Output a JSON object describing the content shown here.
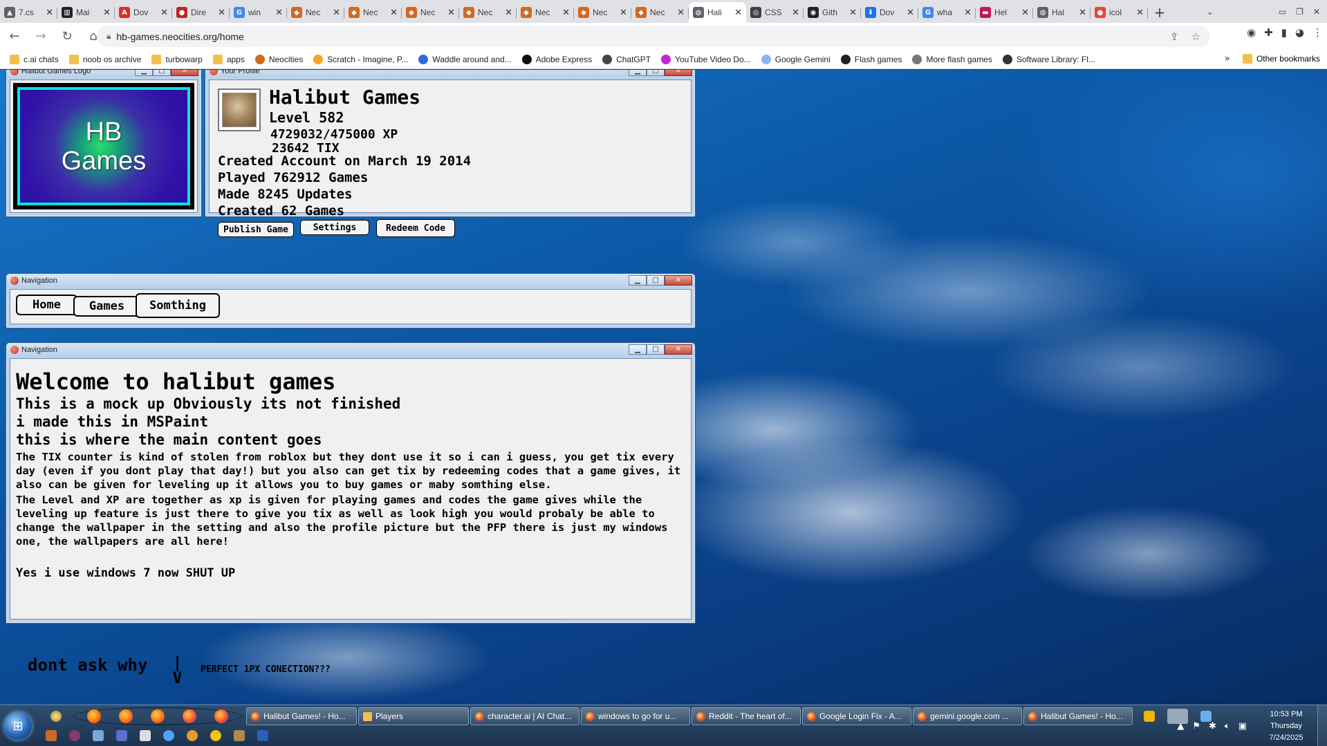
{
  "browser": {
    "tabs": [
      {
        "label": "7.cs",
        "color": "#5f6368",
        "glyph": "▲",
        "active": false
      },
      {
        "label": "Mai",
        "color": "#202124",
        "glyph": "▥",
        "active": false
      },
      {
        "label": "Dov",
        "color": "#d93025",
        "glyph": "A",
        "active": false
      },
      {
        "label": "Dire",
        "color": "#c5221f",
        "glyph": "●",
        "active": false
      },
      {
        "label": "win",
        "color": "#4285f4",
        "glyph": "G",
        "active": false
      },
      {
        "label": "Nec",
        "color": "#d2691e",
        "glyph": "◆",
        "active": false
      },
      {
        "label": "Nec",
        "color": "#d2691e",
        "glyph": "◆",
        "active": false
      },
      {
        "label": "Nec",
        "color": "#d2691e",
        "glyph": "◆",
        "active": false
      },
      {
        "label": "Nec",
        "color": "#d2691e",
        "glyph": "◆",
        "active": false
      },
      {
        "label": "Nec",
        "color": "#d2691e",
        "glyph": "◆",
        "active": false
      },
      {
        "label": "Nec",
        "color": "#d2691e",
        "glyph": "◆",
        "active": false
      },
      {
        "label": "Nec",
        "color": "#d2691e",
        "glyph": "◆",
        "active": false
      },
      {
        "label": "Hali",
        "color": "#5f6368",
        "glyph": "◍",
        "active": true
      },
      {
        "label": "CSS",
        "color": "#3c4043",
        "glyph": "◎",
        "active": false
      },
      {
        "label": "Gith",
        "color": "#202124",
        "glyph": "◉",
        "active": false
      },
      {
        "label": "Dov",
        "color": "#1a73e8",
        "glyph": "⬇",
        "active": false
      },
      {
        "label": "wha",
        "color": "#4285f4",
        "glyph": "G",
        "active": false
      },
      {
        "label": "Hel",
        "color": "#c2185b",
        "glyph": "▬",
        "active": false
      },
      {
        "label": "Hal",
        "color": "#5f6368",
        "glyph": "◍",
        "active": false
      },
      {
        "label": "icol",
        "color": "#ea4335",
        "glyph": "●",
        "active": false
      }
    ],
    "url": "hb-games.neocities.org/home",
    "bookmarks": [
      {
        "label": "c.ai chats",
        "folder": true,
        "color": "#f2c14b"
      },
      {
        "label": "noob os archive",
        "folder": true,
        "color": "#f2c14b"
      },
      {
        "label": "turbowarp",
        "folder": true,
        "color": "#f2c14b"
      },
      {
        "label": "apps",
        "folder": true,
        "color": "#f2c14b"
      },
      {
        "label": "Neocities",
        "folder": false,
        "color": "#d2691e"
      },
      {
        "label": "Scratch - Imagine, P...",
        "folder": false,
        "color": "#f5a623"
      },
      {
        "label": "Waddle around and...",
        "folder": false,
        "color": "#2d6cdf"
      },
      {
        "label": "Adobe Express",
        "folder": false,
        "color": "#111111"
      },
      {
        "label": "ChatGPT",
        "folder": false,
        "color": "#444444"
      },
      {
        "label": "YouTube Video Do...",
        "folder": false,
        "color": "#c026d3"
      },
      {
        "label": "Google Gemini",
        "folder": false,
        "color": "#8ab4f8"
      },
      {
        "label": "Flash games",
        "folder": false,
        "color": "#222222"
      },
      {
        "label": "More flash games",
        "folder": false,
        "color": "#777777"
      },
      {
        "label": "Software Library: Fl...",
        "folder": false,
        "color": "#333333"
      }
    ],
    "other_bookmarks": "Other bookmarks"
  },
  "windows": {
    "logo": {
      "title": "Halibut Games Logo",
      "logo_line1": "HB",
      "logo_line2": "Games"
    },
    "profile": {
      "title": "Your Profile",
      "username": "Halibut Games",
      "level": "Level 582",
      "xp": "4729032/475000 XP",
      "tix": "23642 TIX",
      "created": "Created Account on March 19 2014",
      "played": "Played 762912 Games",
      "updates": "Made 8245 Updates",
      "games_created": "Created 62 Games",
      "buttons": {
        "publish": "Publish Game",
        "settings": "Settings",
        "redeem": "Redeem Code"
      }
    },
    "navigation": {
      "title": "Navigation",
      "home": "Home",
      "games": "Games",
      "something": "Somthing"
    },
    "main": {
      "title": "Navigation",
      "heading": "Welcome to halibut games",
      "sub1": "This is a mock up Obviously its not finished",
      "sub2": "i made this in MSPaint",
      "sub3": "this is where the main content goes",
      "para1": "The TIX counter is kind of stolen from roblox but they dont use it so i can i guess, you get tix every day (even if you dont play that day!) but you also can get tix by redeeming codes that a game gives, it also can be given for leveling up it allows you to buy games or maby somthing else.",
      "para2": "The Level and XP are together as xp is given for playing games and codes the game gives while the leveling up feature is just there to give you tix as well as look high you would probaly be able to change the wallpaper in the setting and also the profile picture but the PFP there is just my windows one, the wallpapers are all here!",
      "para3": "Yes i use windows 7 now SHUT UP"
    }
  },
  "desktop": {
    "note1": "dont ask why",
    "arrow": "|\nV",
    "note2": "PERFECT 1PX CONECTION???"
  },
  "taskbar": {
    "tasks": [
      "Halibut Games! - Ho...",
      "Players",
      "character.ai | AI Chat...",
      "windows to go for u...",
      "Reddit - The heart of...",
      "Google Login Fix - A...",
      "gemini.google.com ...",
      "Halibut Games! - Ho..."
    ],
    "time": "10:53 PM",
    "day": "Thursday",
    "date": "7/24/2025"
  }
}
